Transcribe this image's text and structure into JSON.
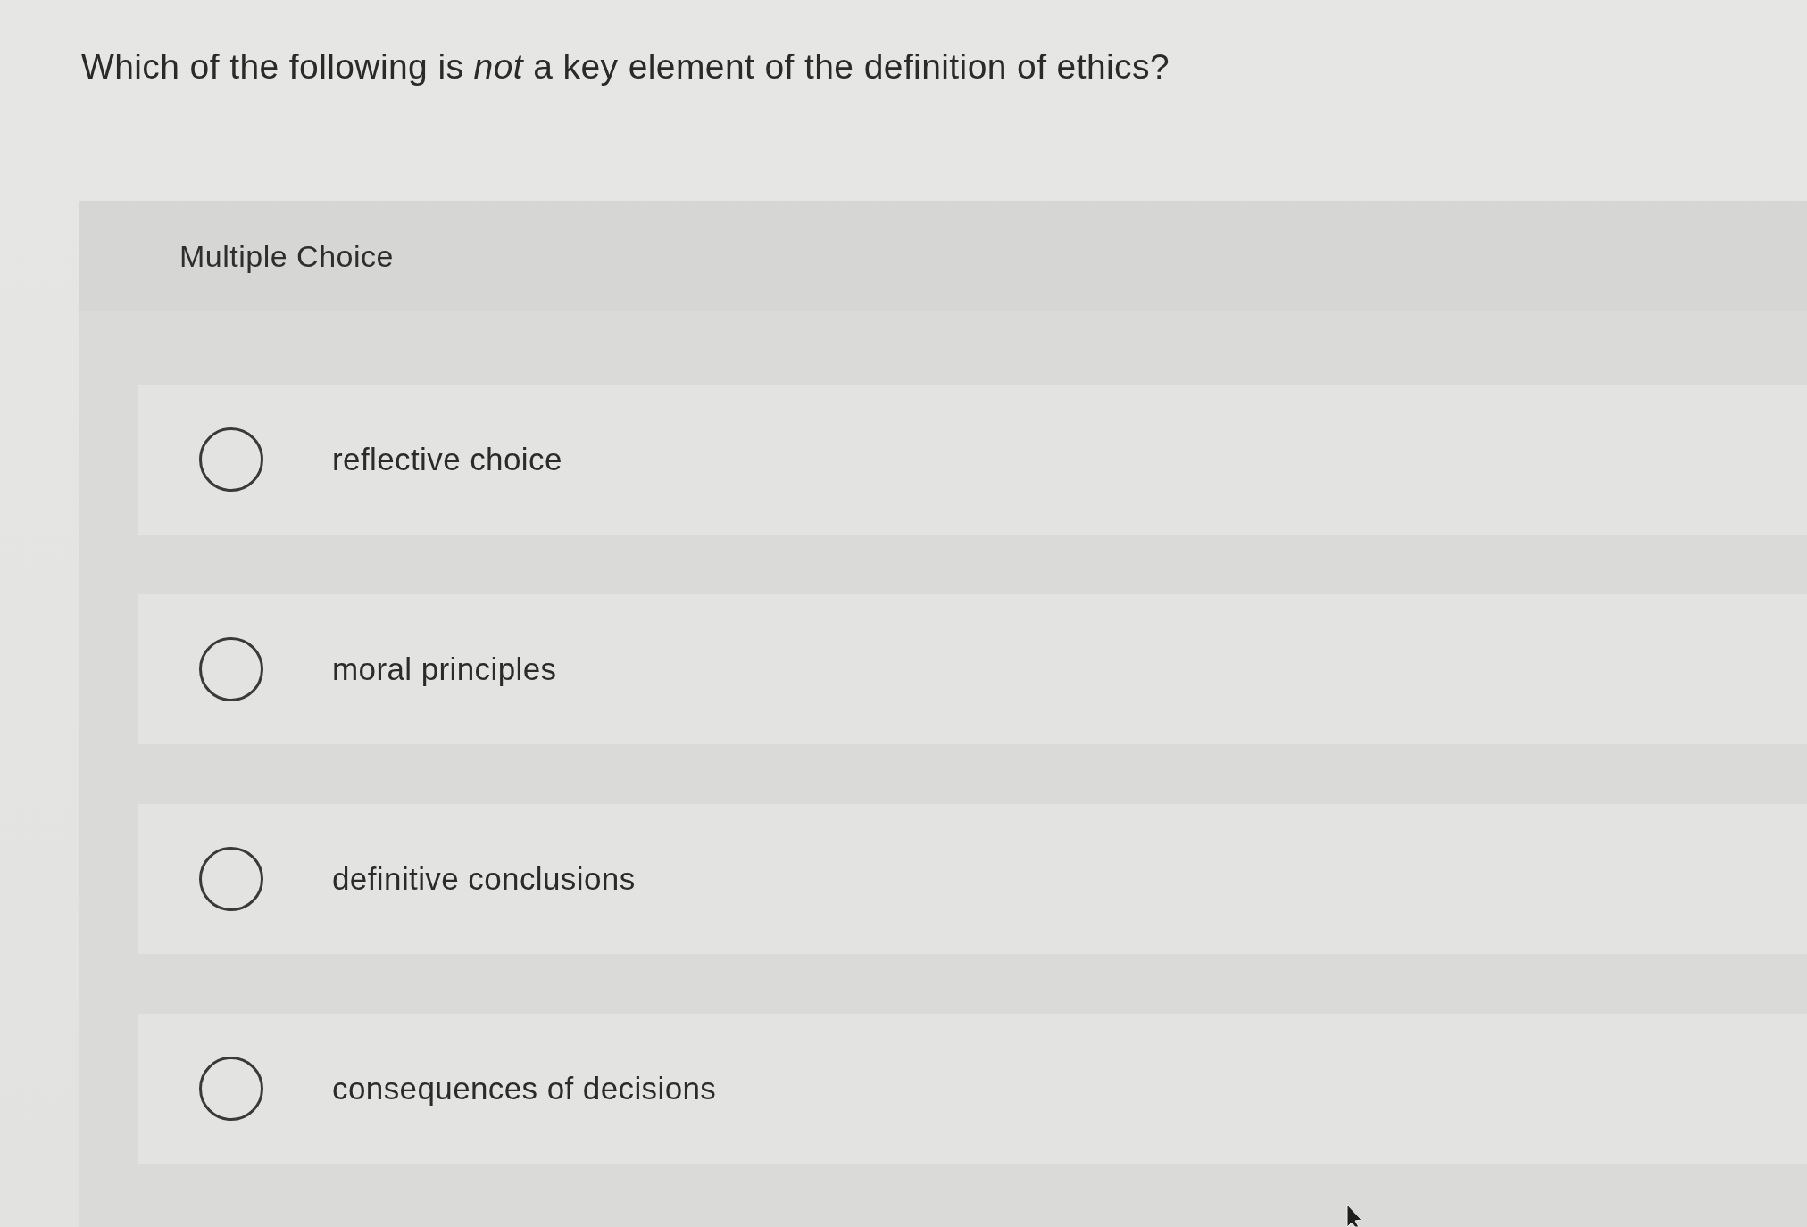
{
  "question": {
    "text": "Which of the following is *not* a key element of the definition of ethics?"
  },
  "answer_panel": {
    "title": "Multiple Choice",
    "options": [
      {
        "label": "reflective choice",
        "selected": false
      },
      {
        "label": "moral principles",
        "selected": false
      },
      {
        "label": "definitive conclusions",
        "selected": false
      },
      {
        "label": "consequences of decisions",
        "selected": false
      }
    ]
  }
}
